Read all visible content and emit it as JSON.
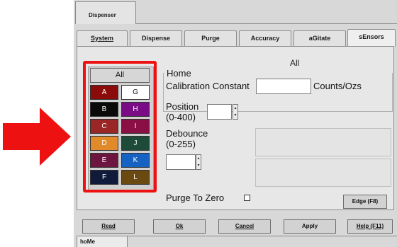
{
  "window_tab": "Dispenser",
  "tabs": [
    {
      "label": "System"
    },
    {
      "label": "Dispense"
    },
    {
      "label": "Purge"
    },
    {
      "label": "Accuracy"
    },
    {
      "label": "aGitate"
    },
    {
      "label": "sEnsors"
    }
  ],
  "active_tab": "sEnsors",
  "panel_title": "All",
  "selector": {
    "all_label": "All",
    "cells": [
      {
        "label": "A",
        "color": "#8b0a0a",
        "text_color": "#ffffff"
      },
      {
        "label": "G",
        "color": "#ffffff",
        "text_color": "#111111"
      },
      {
        "label": "B",
        "color": "#0a0a0a",
        "text_color": "#ffffff"
      },
      {
        "label": "H",
        "color": "#7a0d86",
        "text_color": "#ffffff"
      },
      {
        "label": "C",
        "color": "#9a2626",
        "text_color": "#ffffff"
      },
      {
        "label": "I",
        "color": "#8a0f45",
        "text_color": "#ffffff"
      },
      {
        "label": "D",
        "color": "#e08a2a",
        "text_color": "#ffffff"
      },
      {
        "label": "J",
        "color": "#1e4a3a",
        "text_color": "#ffffff"
      },
      {
        "label": "E",
        "color": "#6e1440",
        "text_color": "#ffffff"
      },
      {
        "label": "K",
        "color": "#1662c2",
        "text_color": "#ffffff"
      },
      {
        "label": "F",
        "color": "#101a3a",
        "text_color": "#ffffff"
      },
      {
        "label": "L",
        "color": "#6b4a12",
        "text_color": "#ffffff"
      }
    ]
  },
  "home": {
    "group_label": "Home",
    "calibration_label": "Calibration Constant",
    "calibration_value": "",
    "units": "Counts/Ozs",
    "position_label": "Position",
    "position_range": "(0-400)",
    "position_value": ""
  },
  "debounce": {
    "label": "Debounce",
    "range": "(0-255)",
    "value": ""
  },
  "purge_to_zero_label": "Purge To Zero",
  "edge_button": "Edge (F8)",
  "bottom_buttons": {
    "read": "Read",
    "ok": "Ok",
    "cancel": "Cancel",
    "apply": "Apply",
    "help": "Help (F11)"
  },
  "bottom_tab": "hoMe",
  "annotation_arrow_color": "#ee1111"
}
